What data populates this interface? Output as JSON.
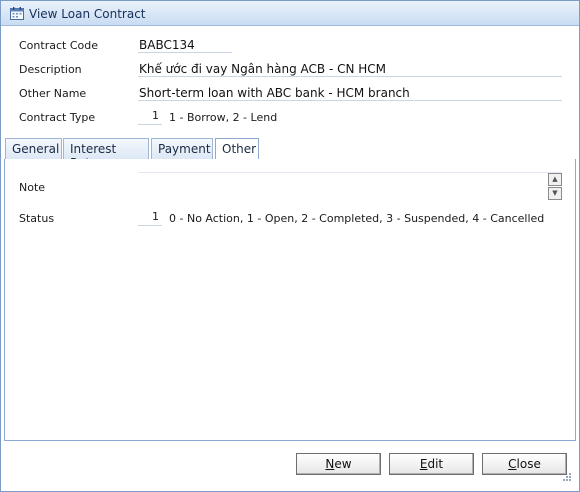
{
  "window": {
    "title": "View Loan Contract",
    "icon": "calendar-icon"
  },
  "fields": {
    "contract_code": {
      "label": "Contract Code",
      "value": "BABC134"
    },
    "description": {
      "label": "Description",
      "value": "Khế ước đi vay Ngân hàng ACB - CN HCM"
    },
    "other_name": {
      "label": "Other Name",
      "value": "Short-term loan with ABC bank - HCM branch"
    },
    "contract_type": {
      "label": "Contract Type",
      "value": "1",
      "hint": "1 - Borrow, 2 - Lend"
    }
  },
  "tabs": [
    {
      "label": "General"
    },
    {
      "label": "Interest Rate"
    },
    {
      "label": "Payment"
    },
    {
      "label": "Other",
      "active": true
    }
  ],
  "other_tab": {
    "note": {
      "label": "Note",
      "value": ""
    },
    "status": {
      "label": "Status",
      "value": "1",
      "hint": "0 - No Action, 1 - Open, 2 - Completed, 3 - Suspended, 4 - Cancelled"
    }
  },
  "buttons": {
    "new": {
      "hotkey": "N",
      "rest": "ew"
    },
    "edit": {
      "hotkey": "E",
      "rest": "dit"
    },
    "close": {
      "hotkey": "C",
      "rest": "lose"
    }
  }
}
